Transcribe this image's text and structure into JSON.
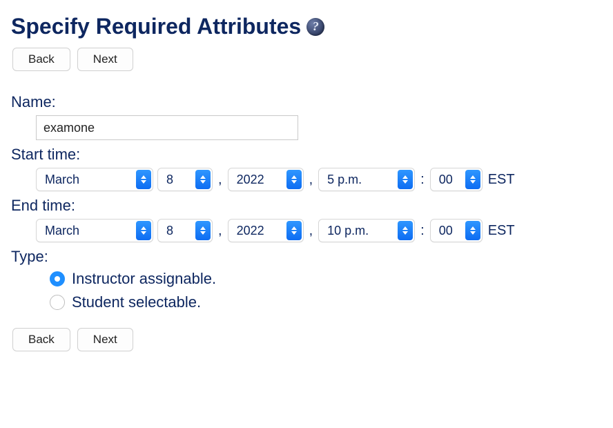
{
  "page_title": "Specify Required Attributes",
  "help_icon_glyph": "?",
  "buttons": {
    "back": "Back",
    "next": "Next"
  },
  "labels": {
    "name": "Name:",
    "start_time": "Start time:",
    "end_time": "End time:",
    "type": "Type:"
  },
  "name_value": "examone",
  "separators": {
    "comma": ",",
    "colon": ":"
  },
  "timezone": "EST",
  "start": {
    "month": "March",
    "day": "8",
    "year": "2022",
    "hour": "5 p.m.",
    "minute": "00"
  },
  "end": {
    "month": "March",
    "day": "8",
    "year": "2022",
    "hour": "10 p.m.",
    "minute": "00"
  },
  "type_options": {
    "instructor": "Instructor assignable.",
    "student": "Student selectable."
  },
  "type_selected": "instructor"
}
